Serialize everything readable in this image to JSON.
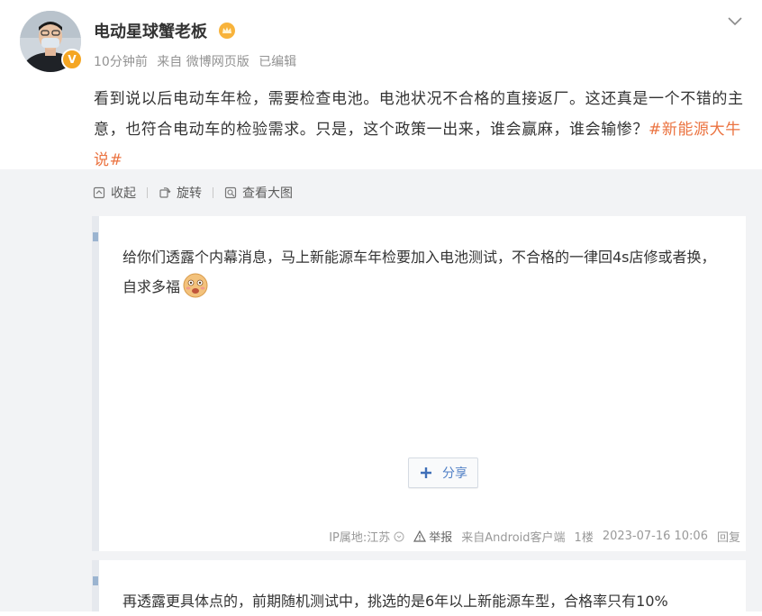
{
  "post": {
    "username": "电动星球蟹老板",
    "time": "10分钟前",
    "source": "来自 微博网页版",
    "edited": "已编辑",
    "text": "看到说以后电动车年检，需要检查电池。电池状况不合格的直接返厂。这还真是一个不错的主意，也符合电动车的检验需求。只是，这个政策一出来，谁会赢麻，谁会输惨？",
    "hashtag": "#新能源大牛说#"
  },
  "toolbar": {
    "collapse_label": "收起",
    "rotate_label": "旋转",
    "view_large_label": "查看大图"
  },
  "image": {
    "reply1": {
      "text": "给你们透露个内幕消息，马上新能源车年检要加入电池测试，不合格的一律回4s店修或者换，自求多福",
      "share_label": "分享",
      "ip": "IP属地:江苏",
      "report": "举报",
      "client": "来自Android客户端",
      "floor": "1楼",
      "datetime": "2023-07-16 10:06",
      "reply": "回复"
    },
    "reply2": {
      "text": "再透露更具体点的，前期随机测试中，挑选的是6年以上新能源车型，合格率只有10%"
    }
  },
  "colors": {
    "hashtag": "#eb7340",
    "badge": "#f5a623",
    "share": "#4f7fc5",
    "meta": "#939393"
  }
}
